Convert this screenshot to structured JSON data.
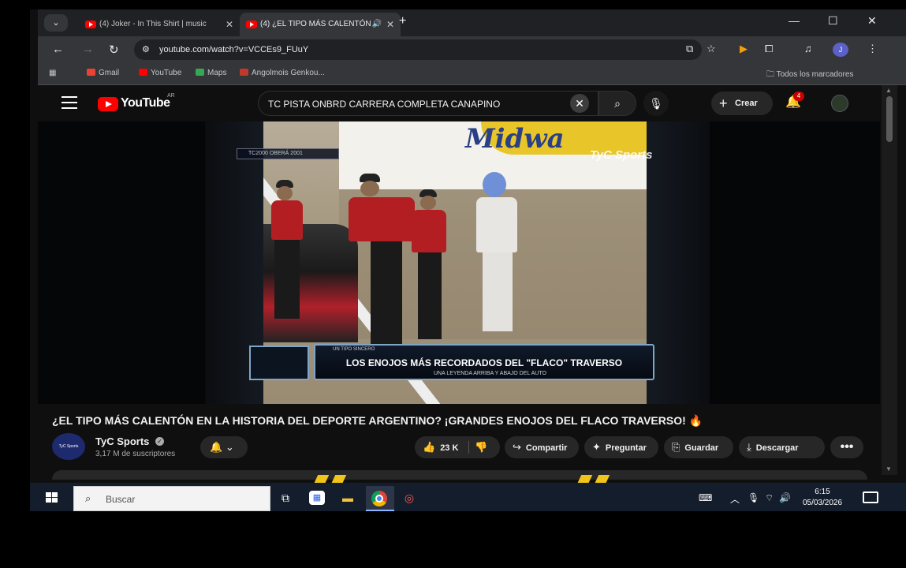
{
  "browser": {
    "tabs": [
      {
        "label": "(4) Joker - In This Shirt | music",
        "active": false
      },
      {
        "label": "(4) ¿EL TIPO MÁS CALENTÓN",
        "active": true
      }
    ],
    "url": "youtube.com/watch?v=VCCEs9_FUuY",
    "bookmarks": [
      "Gmail",
      "YouTube",
      "Maps",
      "Angolmois Genkou..."
    ],
    "all_bookmarks": "Todos los marcadores",
    "profile_initial": "J"
  },
  "youtube": {
    "logo_text": "YouTube",
    "country_code": "AR",
    "search_query": "TC  PISTA ONBRD CARRERA COMPLETA CANAPINO",
    "create_label": "Crear",
    "notification_count": "4"
  },
  "video": {
    "top_tag": "TC2000 OBERÁ 2001",
    "watermark": "TyC Sports",
    "banner_text": "Midwa",
    "lower_kicker": "UN TIPO SINCERO",
    "lower_title": "LOS ENOJOS MÁS RECORDADOS DEL \"FLACO\" TRAVERSO",
    "lower_sub": "UNA LEYENDA ARRIBA Y ABAJO DEL AUTO"
  },
  "details": {
    "title": "¿EL TIPO MÁS CALENTÓN EN LA HISTORIA DEL DEPORTE ARGENTINO? ¡GRANDES ENOJOS DEL FLACO TRAVERSO! 🔥",
    "channel_name": "TyC Sports",
    "subscribers": "3,17 M de suscriptores",
    "avatar_text": "TyC Sports",
    "likes": "23 K",
    "share_label": "Compartir",
    "ask_label": "Preguntar",
    "save_label": "Guardar",
    "download_label": "Descargar"
  },
  "taskbar": {
    "search_placeholder": "Buscar",
    "time": "6:15",
    "date": "05/03/2026"
  }
}
